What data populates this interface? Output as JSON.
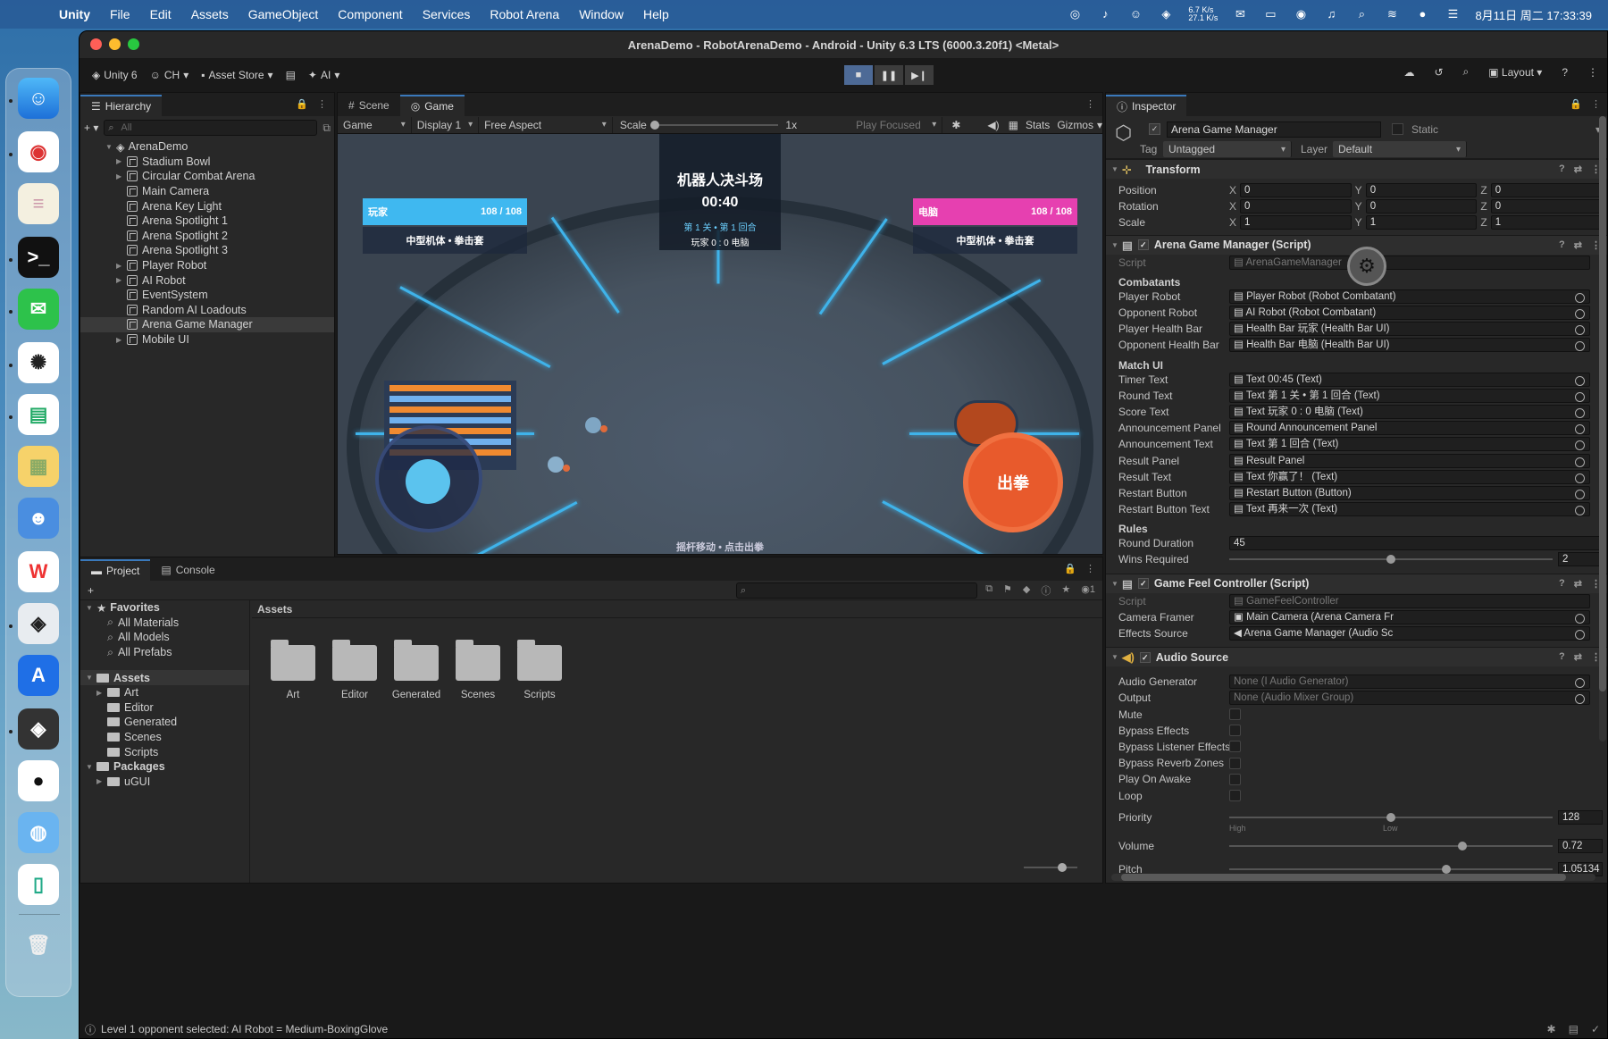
{
  "menubar": {
    "app": "Unity",
    "items": [
      "File",
      "Edit",
      "Assets",
      "GameObject",
      "Component",
      "Services",
      "Robot Arena",
      "Window",
      "Help"
    ],
    "net_up": "6.7 K/s",
    "net_down": "27.1 K/s",
    "datetime": "8月11日 周二  17:33:39"
  },
  "window": {
    "title": "ArenaDemo - RobotArenaDemo - Android - Unity 6.3 LTS (6000.3.20f1) <Metal>"
  },
  "toolbar": {
    "account": "Unity 6",
    "user": "CH",
    "asset_store": "Asset Store",
    "ai": "AI",
    "layout": "Layout"
  },
  "hierarchy": {
    "tab": "Hierarchy",
    "search_placeholder": "All",
    "scene": "ArenaDemo",
    "items": [
      {
        "label": "Stadium Bowl",
        "expand": true
      },
      {
        "label": "Circular Combat Arena",
        "expand": true
      },
      {
        "label": "Main Camera",
        "expand": false
      },
      {
        "label": "Arena Key Light",
        "expand": false
      },
      {
        "label": "Arena Spotlight 1",
        "expand": false
      },
      {
        "label": "Arena Spotlight 2",
        "expand": false
      },
      {
        "label": "Arena Spotlight 3",
        "expand": false
      },
      {
        "label": "Player Robot",
        "expand": true
      },
      {
        "label": "AI Robot",
        "expand": true
      },
      {
        "label": "EventSystem",
        "expand": false
      },
      {
        "label": "Random AI Loadouts",
        "expand": false
      },
      {
        "label": "Arena Game Manager",
        "expand": false,
        "selected": true
      },
      {
        "label": "Mobile UI",
        "expand": true
      }
    ]
  },
  "game": {
    "tab_scene": "Scene",
    "tab_game": "Game",
    "mode": "Game",
    "display": "Display 1",
    "aspect": "Free Aspect",
    "scale_label": "Scale",
    "scale_value": "1x",
    "play_focused": "Play Focused",
    "stats": "Stats",
    "gizmos": "Gizmos",
    "hud": {
      "title": "机器人决斗场",
      "timer": "00:40",
      "round": "第 1 关 • 第 1 回合",
      "score": "玩家 0 : 0 电脑",
      "player_label": "玩家",
      "player_hp": "108 / 108",
      "player_hp_fraction": 1.0,
      "ai_label": "电脑",
      "ai_hp": "108 / 108",
      "ai_hp_fraction": 1.0,
      "player_loadout": "中型机体 • 拳击套",
      "ai_loadout": "中型机体 • 拳击套",
      "punch_button": "出拳",
      "hint": "摇杆移动 • 点击出拳"
    }
  },
  "inspector": {
    "tab": "Inspector",
    "object_name": "Arena Game Manager",
    "static_label": "Static",
    "tag_label": "Tag",
    "tag_value": "Untagged",
    "layer_label": "Layer",
    "layer_value": "Default",
    "transform": {
      "title": "Transform",
      "position_label": "Position",
      "rotation_label": "Rotation",
      "scale_label": "Scale",
      "position": [
        "0",
        "0",
        "0"
      ],
      "rotation": [
        "0",
        "0",
        "0"
      ],
      "scale": [
        "1",
        "1",
        "1"
      ]
    },
    "agm": {
      "title": "Arena Game Manager (Script)",
      "script_label": "Script",
      "script_value": "ArenaGameManager",
      "combatants_header": "Combatants",
      "combatants": [
        {
          "label": "Player Robot",
          "value": "Player Robot (Robot Combatant)"
        },
        {
          "label": "Opponent Robot",
          "value": "AI Robot (Robot Combatant)"
        },
        {
          "label": "Player Health Bar",
          "value": "Health Bar 玩家 (Health Bar UI)"
        },
        {
          "label": "Opponent Health Bar",
          "value": "Health Bar 电脑 (Health Bar UI)"
        }
      ],
      "match_ui_header": "Match UI",
      "match_ui": [
        {
          "label": "Timer Text",
          "value": "Text 00:45 (Text)"
        },
        {
          "label": "Round Text",
          "value": "Text 第 1 关 • 第 1 回合 (Text)"
        },
        {
          "label": "Score Text",
          "value": "Text 玩家 0 : 0 电脑 (Text)"
        },
        {
          "label": "Announcement Panel",
          "value": "Round Announcement Panel"
        },
        {
          "label": "Announcement Text",
          "value": "Text 第 1 回合 (Text)"
        },
        {
          "label": "Result Panel",
          "value": "Result Panel"
        },
        {
          "label": "Result Text",
          "value": "Text 你赢了！ (Text)"
        },
        {
          "label": "Restart Button",
          "value": "Restart Button (Button)"
        },
        {
          "label": "Restart Button Text",
          "value": "Text 再来一次 (Text)"
        }
      ],
      "rules_header": "Rules",
      "round_duration_label": "Round Duration",
      "round_duration": "45",
      "wins_required_label": "Wins Required",
      "wins_required": "2",
      "wins_slider_fraction": 0.5
    },
    "gfc": {
      "title": "Game Feel Controller (Script)",
      "script_label": "Script",
      "script_value": "GameFeelController",
      "camera_framer_label": "Camera Framer",
      "camera_framer": "Main Camera (Arena Camera Fr",
      "effects_source_label": "Effects Source",
      "effects_source": "Arena Game Manager (Audio Sc"
    },
    "audio": {
      "title": "Audio Source",
      "generator_label": "Audio Generator",
      "generator": "None (I Audio Generator)",
      "output_label": "Output",
      "output": "None (Audio Mixer Group)",
      "toggles": [
        "Mute",
        "Bypass Effects",
        "Bypass Listener Effects",
        "Bypass Reverb Zones",
        "Play On Awake",
        "Loop"
      ],
      "priority_label": "Priority",
      "priority": "128",
      "priority_fraction": 0.5,
      "high": "High",
      "low": "Low",
      "volume_label": "Volume",
      "volume": "0.72",
      "volume_fraction": 0.72,
      "pitch_label": "Pitch",
      "pitch": "1.05134",
      "pitch_fraction": 0.67
    }
  },
  "project": {
    "tab_project": "Project",
    "tab_console": "Console",
    "favorites": "Favorites",
    "favorite_items": [
      "All Materials",
      "All Models",
      "All Prefabs"
    ],
    "assets": "Assets",
    "asset_folders": [
      "Art",
      "Editor",
      "Generated",
      "Scenes",
      "Scripts"
    ],
    "packages": "Packages",
    "package_folders": [
      "uGUI"
    ],
    "breadcrumb": "Assets",
    "badge_count": "1"
  },
  "status": {
    "message": "Level 1 opponent selected: AI Robot = Medium-BoxingGlove"
  },
  "colors": {
    "accent": "#3a79bb",
    "player_bar": "#3fb8f0",
    "ai_bar": "#e640b0",
    "punch": "#e85a2c"
  }
}
